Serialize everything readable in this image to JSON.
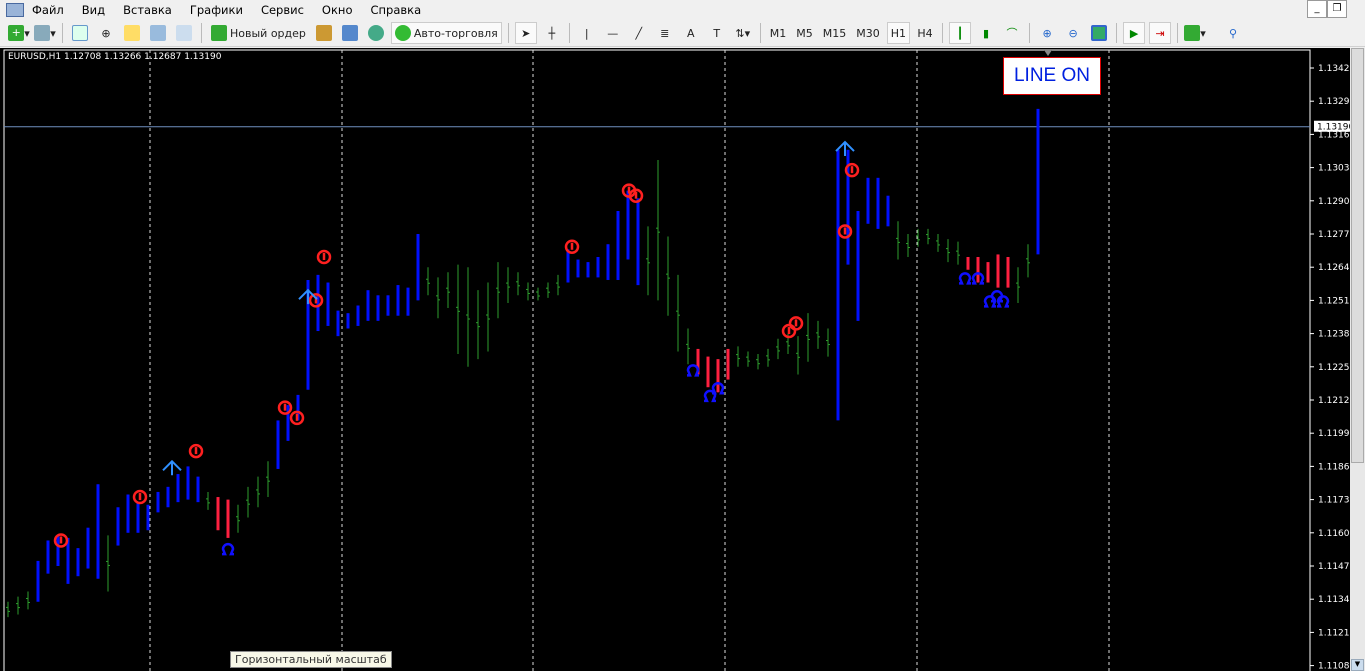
{
  "menu": [
    "Файл",
    "Вид",
    "Вставка",
    "Графики",
    "Сервис",
    "Окно",
    "Справка"
  ],
  "toolbar": {
    "new_order": "Новый ордер",
    "auto_trading": "Авто-торговля",
    "timeframes": [
      "M1",
      "M5",
      "M15",
      "M30",
      "H1",
      "H4"
    ],
    "active_timeframe": "H1"
  },
  "chart": {
    "symbol_info": "EURUSD,H1  1.12708 1.13266 1.12687 1.13190",
    "current_price": "1.13190",
    "current_price_value": 1.1319,
    "line_label": "LINE ON",
    "tooltip": "Горизонтальный масштаб",
    "price_labels": [
      "1.13420",
      "1.13290",
      "1.13160",
      "1.13030",
      "1.12900",
      "1.12770",
      "1.12640",
      "1.12510",
      "1.12380",
      "1.12250",
      "1.12120",
      "1.11990",
      "1.11860",
      "1.11730",
      "1.11600",
      "1.11470",
      "1.11340",
      "1.11210",
      "1.11080"
    ],
    "colors": {
      "trend": "#0010ff",
      "neutral": "#2e9e2e",
      "down": "#ff2040",
      "signal_red": "#ff2020",
      "signal_blue": "#1010ff",
      "arrow": "#3090ff"
    },
    "bars": [
      [
        1.1133,
        1.1127,
        "g"
      ],
      [
        1.1135,
        1.1128,
        "g"
      ],
      [
        1.1137,
        1.113,
        "g"
      ],
      [
        1.1149,
        1.1133,
        "b"
      ],
      [
        1.1157,
        1.1144,
        "b"
      ],
      [
        1.1159,
        1.1147,
        "b"
      ],
      [
        1.1158,
        1.114,
        "b"
      ],
      [
        1.1154,
        1.1143,
        "b"
      ],
      [
        1.1162,
        1.1146,
        "b"
      ],
      [
        1.1179,
        1.1142,
        "b"
      ],
      [
        1.1159,
        1.1137,
        "g"
      ],
      [
        1.117,
        1.1155,
        "b"
      ],
      [
        1.1175,
        1.116,
        "b"
      ],
      [
        1.1172,
        1.116,
        "b"
      ],
      [
        1.1171,
        1.1161,
        "b"
      ],
      [
        1.1176,
        1.1168,
        "b"
      ],
      [
        1.1178,
        1.117,
        "b"
      ],
      [
        1.1183,
        1.1172,
        "b"
      ],
      [
        1.1186,
        1.1173,
        "b"
      ],
      [
        1.1182,
        1.1172,
        "b"
      ],
      [
        1.1176,
        1.1169,
        "g"
      ],
      [
        1.1174,
        1.1161,
        "r"
      ],
      [
        1.1173,
        1.1158,
        "r"
      ],
      [
        1.1171,
        1.116,
        "g"
      ],
      [
        1.1178,
        1.1166,
        "g"
      ],
      [
        1.1182,
        1.117,
        "g"
      ],
      [
        1.1188,
        1.1174,
        "g"
      ],
      [
        1.1204,
        1.1185,
        "b"
      ],
      [
        1.121,
        1.1196,
        "b"
      ],
      [
        1.1214,
        1.1204,
        "b"
      ],
      [
        1.1259,
        1.1216,
        "b"
      ],
      [
        1.1261,
        1.1239,
        "b"
      ],
      [
        1.1258,
        1.1241,
        "b"
      ],
      [
        1.1247,
        1.1237,
        "b"
      ],
      [
        1.1246,
        1.124,
        "b"
      ],
      [
        1.1249,
        1.1241,
        "b"
      ],
      [
        1.1255,
        1.1243,
        "b"
      ],
      [
        1.1253,
        1.1243,
        "b"
      ],
      [
        1.1253,
        1.1245,
        "b"
      ],
      [
        1.1257,
        1.1245,
        "b"
      ],
      [
        1.1256,
        1.1245,
        "b"
      ],
      [
        1.1277,
        1.1251,
        "b"
      ],
      [
        1.1264,
        1.1253,
        "g"
      ],
      [
        1.126,
        1.1244,
        "g"
      ],
      [
        1.1262,
        1.1248,
        "g"
      ],
      [
        1.1265,
        1.123,
        "g"
      ],
      [
        1.1264,
        1.1225,
        "g"
      ],
      [
        1.1255,
        1.1228,
        "g"
      ],
      [
        1.1258,
        1.1231,
        "g"
      ],
      [
        1.1266,
        1.1244,
        "g"
      ],
      [
        1.1264,
        1.125,
        "g"
      ],
      [
        1.1262,
        1.1253,
        "g"
      ],
      [
        1.1258,
        1.1251,
        "g"
      ],
      [
        1.1256,
        1.1251,
        "g"
      ],
      [
        1.1258,
        1.1252,
        "g"
      ],
      [
        1.1261,
        1.1253,
        "g"
      ],
      [
        1.1271,
        1.1258,
        "b"
      ],
      [
        1.1267,
        1.126,
        "b"
      ],
      [
        1.1266,
        1.126,
        "b"
      ],
      [
        1.1268,
        1.126,
        "b"
      ],
      [
        1.1273,
        1.1259,
        "b"
      ],
      [
        1.1286,
        1.1259,
        "b"
      ],
      [
        1.1294,
        1.1267,
        "b"
      ],
      [
        1.1291,
        1.1257,
        "b"
      ],
      [
        1.128,
        1.1253,
        "g"
      ],
      [
        1.1306,
        1.1251,
        "g"
      ],
      [
        1.1276,
        1.1245,
        "g"
      ],
      [
        1.1261,
        1.1231,
        "g"
      ],
      [
        1.124,
        1.1226,
        "g"
      ],
      [
        1.1232,
        1.1222,
        "r"
      ],
      [
        1.1229,
        1.1217,
        "r"
      ],
      [
        1.1228,
        1.1215,
        "r"
      ],
      [
        1.1232,
        1.122,
        "r"
      ],
      [
        1.1233,
        1.1225,
        "g"
      ],
      [
        1.1231,
        1.1225,
        "g"
      ],
      [
        1.123,
        1.1224,
        "g"
      ],
      [
        1.1232,
        1.1225,
        "g"
      ],
      [
        1.1236,
        1.1228,
        "g"
      ],
      [
        1.1238,
        1.123,
        "g"
      ],
      [
        1.1237,
        1.1222,
        "g"
      ],
      [
        1.1246,
        1.1227,
        "g"
      ],
      [
        1.1243,
        1.1232,
        "g"
      ],
      [
        1.124,
        1.1229,
        "g"
      ],
      [
        1.131,
        1.1204,
        "b"
      ],
      [
        1.131,
        1.1265,
        "b"
      ],
      [
        1.1286,
        1.1243,
        "b"
      ],
      [
        1.1299,
        1.1281,
        "b"
      ],
      [
        1.1299,
        1.1279,
        "b"
      ],
      [
        1.1292,
        1.128,
        "b"
      ],
      [
        1.1282,
        1.1267,
        "g"
      ],
      [
        1.1277,
        1.1268,
        "g"
      ],
      [
        1.1279,
        1.1272,
        "g"
      ],
      [
        1.1279,
        1.1273,
        "g"
      ],
      [
        1.1277,
        1.127,
        "g"
      ],
      [
        1.1275,
        1.1266,
        "g"
      ],
      [
        1.1274,
        1.1265,
        "g"
      ],
      [
        1.1268,
        1.1263,
        "r"
      ],
      [
        1.1268,
        1.1258,
        "r"
      ],
      [
        1.1266,
        1.1258,
        "r"
      ],
      [
        1.1269,
        1.1256,
        "r"
      ],
      [
        1.1268,
        1.1256,
        "r"
      ],
      [
        1.1264,
        1.125,
        "g"
      ],
      [
        1.1273,
        1.126,
        "g"
      ],
      [
        1.1326,
        1.1269,
        "b"
      ]
    ],
    "signals": [
      {
        "bar": 5.3,
        "price": 1.1157,
        "type": "sell"
      },
      {
        "bar": 13.2,
        "price": 1.1174,
        "type": "sell"
      },
      {
        "bar": 18.8,
        "price": 1.1192,
        "type": "sell"
      },
      {
        "bar": 27.7,
        "price": 1.1209,
        "type": "sell"
      },
      {
        "bar": 28.9,
        "price": 1.1205,
        "type": "sell"
      },
      {
        "bar": 30.8,
        "price": 1.1251,
        "type": "sell"
      },
      {
        "bar": 31.6,
        "price": 1.1268,
        "type": "sell"
      },
      {
        "bar": 56.4,
        "price": 1.1272,
        "type": "sell"
      },
      {
        "bar": 62.1,
        "price": 1.1294,
        "type": "sell"
      },
      {
        "bar": 62.8,
        "price": 1.1292,
        "type": "sell"
      },
      {
        "bar": 78.1,
        "price": 1.1239,
        "type": "sell"
      },
      {
        "bar": 78.8,
        "price": 1.1242,
        "type": "sell"
      },
      {
        "bar": 83.7,
        "price": 1.1278,
        "type": "sell"
      },
      {
        "bar": 84.4,
        "price": 1.1302,
        "type": "sell"
      },
      {
        "bar": 16.4,
        "price": 1.1188,
        "type": "arrow_up"
      },
      {
        "bar": 30,
        "price": 1.1255,
        "type": "arrow_up"
      },
      {
        "bar": 83.7,
        "price": 1.1313,
        "type": "arrow_up"
      },
      {
        "bar": 22,
        "price": 1.1154,
        "type": "buy"
      },
      {
        "bar": 68.5,
        "price": 1.1224,
        "type": "buy"
      },
      {
        "bar": 70.2,
        "price": 1.1214,
        "type": "buy"
      },
      {
        "bar": 71,
        "price": 1.1217,
        "type": "buy"
      },
      {
        "bar": 95.7,
        "price": 1.126,
        "type": "buy"
      },
      {
        "bar": 97,
        "price": 1.126,
        "type": "buy"
      },
      {
        "bar": 98.2,
        "price": 1.1251,
        "type": "buy"
      },
      {
        "bar": 98.9,
        "price": 1.1253,
        "type": "buy"
      },
      {
        "bar": 99.5,
        "price": 1.1251,
        "type": "buy"
      }
    ]
  }
}
